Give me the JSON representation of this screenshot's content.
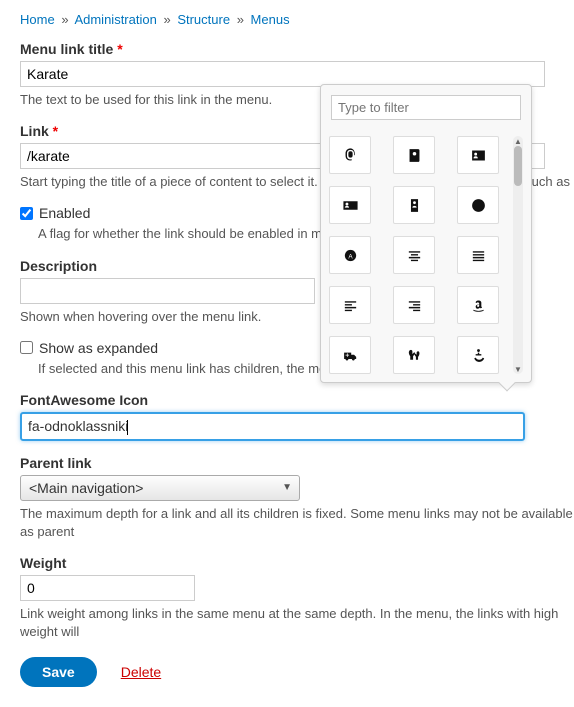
{
  "breadcrumb": {
    "home": "Home",
    "admin": "Administration",
    "structure": "Structure",
    "menus": "Menus",
    "sep": "»"
  },
  "fields": {
    "title": {
      "label": "Menu link title",
      "value": "Karate",
      "desc": "The text to be used for this link in the menu."
    },
    "link": {
      "label": "Link",
      "value": "/karate",
      "desc": "Start typing the title of a piece of content to select it. You can also enter an internal path such as"
    },
    "enabled": {
      "label": "Enabled",
      "desc": "A flag for whether the link should be enabled in menus or hidden."
    },
    "description": {
      "label": "Description",
      "value": "",
      "desc": "Shown when hovering over the menu link."
    },
    "expanded": {
      "label": "Show as expanded",
      "desc": "If selected and this menu link has children, the menu will always appear expanded."
    },
    "faicon": {
      "label": "FontAwesome Icon",
      "value": "fa-odnoklassniki"
    },
    "parent": {
      "label": "Parent link",
      "value": "<Main navigation>",
      "desc": "The maximum depth for a link and all its children is fixed. Some menu links may not be available as parent"
    },
    "weight": {
      "label": "Weight",
      "value": "0",
      "desc": "Link weight among links in the same menu at the same depth. In the menu, the links with high weight will"
    }
  },
  "picker": {
    "filter_placeholder": "Type to filter",
    "icons": [
      "fingerprint",
      "address-book",
      "address-card",
      "id-card",
      "id-badge",
      "adjust",
      "circle-a",
      "align-center",
      "align-justify",
      "align-left",
      "align-right",
      "amazon",
      "ambulance",
      "asl",
      "anchor"
    ]
  },
  "actions": {
    "save": "Save",
    "delete": "Delete"
  }
}
